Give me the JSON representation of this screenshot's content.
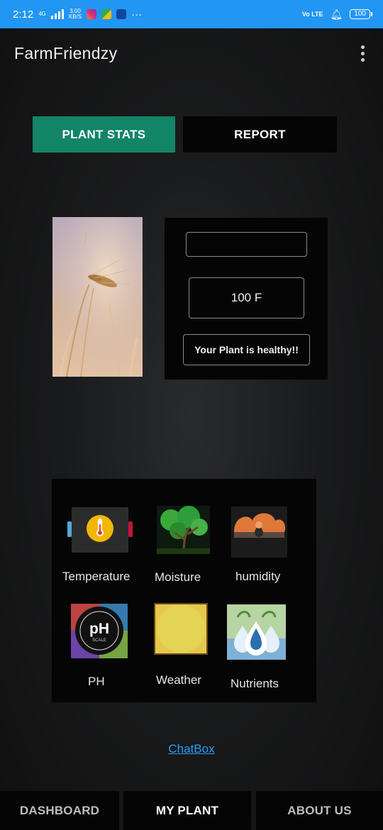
{
  "status_bar": {
    "time": "2:12",
    "net_type": "4G",
    "speed_value": "3.00",
    "speed_unit": "KB/S",
    "more": "···",
    "volte": "Vo LTE",
    "battery": "100"
  },
  "app": {
    "title": "FarmFriendzy"
  },
  "tabs": {
    "plant_stats": "PLANT STATS",
    "report": "REPORT"
  },
  "stats": {
    "blank_value": "",
    "temperature": "100 F",
    "health": "Your Plant is healthy!!"
  },
  "sensors": {
    "temperature": "Temperature",
    "moisture": "Moisture",
    "humidity": "humidity",
    "ph": "PH",
    "ph_icon_text": "pH",
    "ph_icon_sub": "SCALE",
    "weather": "Weather",
    "nutrients": "Nutrients"
  },
  "chatbox": "ChatBox",
  "bottom_nav": {
    "dashboard": "DASHBOARD",
    "my_plant": "MY PLANT",
    "about_us": "ABOUT US"
  },
  "colors": {
    "status_bar": "#2196f3",
    "accent": "#128567",
    "link": "#2a9df4"
  }
}
